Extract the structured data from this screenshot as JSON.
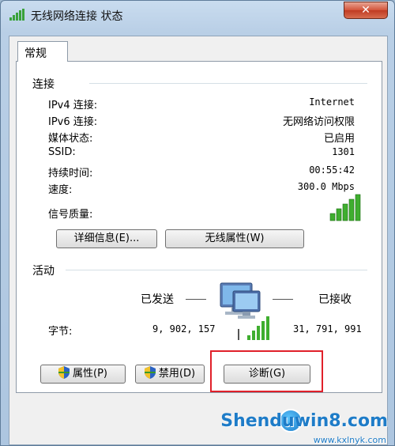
{
  "window": {
    "title": "无线网络连接 状态",
    "close_label": "✕",
    "accent": "#1e7cc8"
  },
  "tabs": [
    {
      "label": "常规"
    }
  ],
  "connection": {
    "title": "连接",
    "rows": [
      {
        "label": "IPv4 连接:",
        "value": "Internet"
      },
      {
        "label": "IPv6 连接:",
        "value": "无网络访问权限"
      },
      {
        "label": "媒体状态:",
        "value": "已启用"
      },
      {
        "label": "SSID:",
        "value": "1301"
      },
      {
        "label": "持续时间:",
        "value": "00:55:42"
      },
      {
        "label": "速度:",
        "value": "300.0 Mbps"
      }
    ],
    "signal_label": "信号质量:",
    "signal_bars": 5,
    "signal_icon": "signal-strength-icon"
  },
  "buttons": {
    "details": "详细信息(E)...",
    "wireless_properties": "无线属性(W)"
  },
  "activity": {
    "title": "活动",
    "sent_label": "已发送",
    "received_label": "已接收",
    "bytes_label": "字节:",
    "sent_value": "9, 902, 157",
    "received_value": "31, 791, 991",
    "network_icon": "network-computer-icon"
  },
  "bottom_buttons": {
    "properties": "属性(P)",
    "disable": "禁用(D)",
    "diagnose": "诊断(G)"
  },
  "watermark": {
    "brand": "Shenduwin8.com",
    "url": "www.kxlnyk.com"
  }
}
